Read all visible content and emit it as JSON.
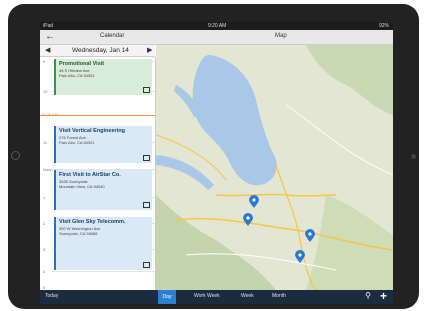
{
  "status_bar": {
    "carrier": "iPad",
    "time": "9:20 AM",
    "battery": "92%"
  },
  "top_bar": {
    "back_icon": "back-arrow-icon",
    "calendar_title": "Calendar",
    "map_title": "Map"
  },
  "date_nav": {
    "prev_icon": "chevron-left-icon",
    "date": "Wednesday, Jan 14",
    "next_icon": "chevron-right-icon"
  },
  "calendar": {
    "hour_labels": [
      "9",
      "10",
      "11",
      "Noon",
      "1",
      "2",
      "3",
      "4",
      "5"
    ],
    "now_label": "10:20 AM",
    "events": [
      {
        "title": "Promotional Visit",
        "line1": "45 S Hillview Ave",
        "line2": "Palo Alto, CA 94301",
        "color": "#3c8f56"
      },
      {
        "title": "Visit Vertical Engineering",
        "line1": "276 Forest Ave",
        "line2": "Palo Alto, CA 94301",
        "color": "#2f6fb0"
      },
      {
        "title": "First Visit to AirStar Co.",
        "line1": "3535 Sunnyvale",
        "line2": "Mountain View, CA 94040",
        "color": "#2f6fb0"
      },
      {
        "title": "Visit Glen Sky Telecomm.",
        "line1": "300 W Washington Ave",
        "line2": "Sunnyvale, CA 94086",
        "color": "#2f6fb0"
      }
    ]
  },
  "map": {
    "pin_icon": "map-pin-icon",
    "pin_color": "#2b78d4"
  },
  "bottom_bar": {
    "today": "Today",
    "tabs": [
      "Day",
      "Work Week",
      "Week",
      "Month"
    ],
    "selected_tab": "Day",
    "search_icon": "search-icon",
    "add_icon": "plus-icon"
  }
}
